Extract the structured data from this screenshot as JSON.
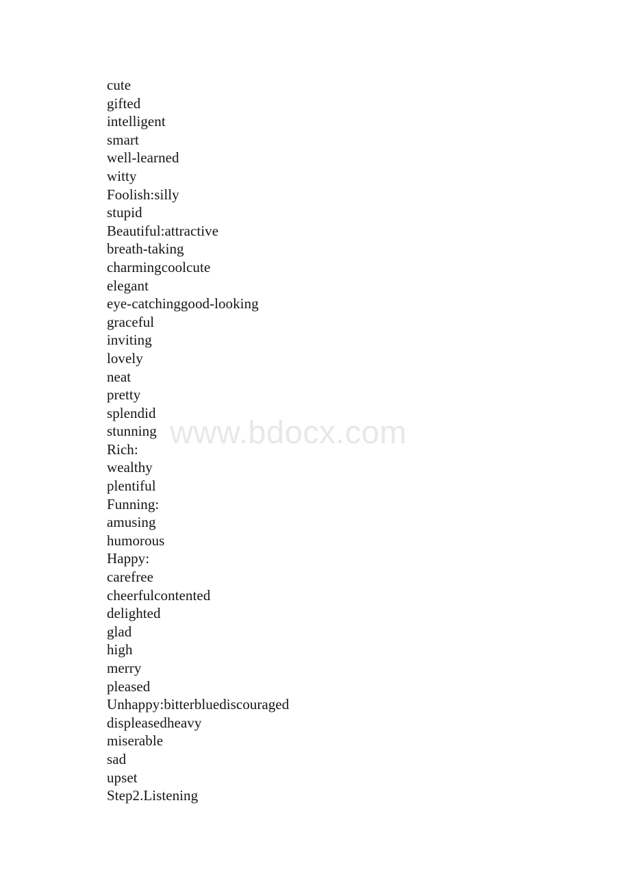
{
  "document": {
    "page_background": "#ffffff",
    "text_color": "#161616",
    "watermark": {
      "text": "www.bdocx.com",
      "color": "#e7e8e8"
    },
    "lines": [
      "cute",
      "gifted",
      "intelligent",
      "smart",
      "well-learned",
      "witty",
      "Foolish:silly",
      "stupid",
      "Beautiful:attractive",
      "breath-taking",
      "charmingcoolcute",
      "elegant",
      "eye-catchinggood-looking",
      "graceful",
      "inviting",
      "lovely",
      "neat",
      "pretty",
      "splendid",
      "stunning",
      "Rich:",
      "wealthy",
      "plentiful",
      "Funning:",
      "amusing",
      "humorous",
      "Happy:",
      "carefree",
      "cheerfulcontented",
      "delighted",
      "glad",
      "high",
      "merry",
      "pleased",
      "Unhappy:bitterbluediscouraged",
      "displeasedheavy",
      "miserable",
      "sad",
      "upset",
      "Step2.Listening"
    ]
  }
}
